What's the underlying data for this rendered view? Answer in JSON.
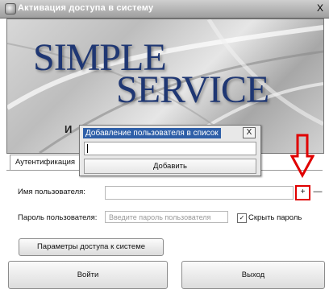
{
  "window": {
    "title": "Активация доступа в систему",
    "close_label": "X"
  },
  "banner": {
    "line1": "SIMPLE",
    "line2": "SERVICE",
    "fragment": "И"
  },
  "tabs": [
    {
      "label": "Аутентификация"
    }
  ],
  "form": {
    "username_label": "Имя пользователя:",
    "add_label": "+",
    "remove_label": "—",
    "password_label": "Пароль пользователя:",
    "password_placeholder": "Введите пароль пользователя",
    "hide_password_label": "Скрыть пароль",
    "hide_password_check": "✓"
  },
  "buttons": {
    "params": "Параметры доступа к системе",
    "login": "Войти",
    "exit": "Выход"
  },
  "dialog": {
    "title": "Добавление пользователя в список",
    "close_label": "X",
    "add_button": "Добавить"
  },
  "colors": {
    "highlight": "#e00000",
    "logo": "#1f3773"
  }
}
